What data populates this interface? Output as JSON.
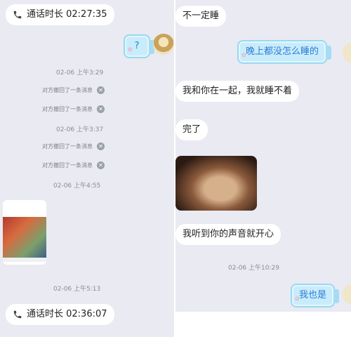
{
  "left": {
    "call_top": "通话时长 02:27:35",
    "outgoing_question": "?",
    "timestamps": [
      "02-06 上午3:29",
      "02-06 上午3:37",
      "02-06 上午4:55",
      "02-06 上午5:13"
    ],
    "recall_notice": "对方撤回了一条消息",
    "call_bottom": "通话时长 02:36:07"
  },
  "right": {
    "msg1": "不一定睡",
    "msg2": "晚上都没怎么睡的",
    "msg3": "我和你在一起，我就睡不着",
    "msg4": "完了",
    "msg5": "我听到你的声音就开心",
    "timestamp": "02-06 上午10:29",
    "msg6": "我也是"
  },
  "colors": {
    "panel_bg": "#e9eaf2",
    "bubble_blue": "#c9ecfb",
    "blue_text": "#2b7dd6"
  },
  "icons": [
    "phone-icon",
    "close-circle-icon"
  ]
}
